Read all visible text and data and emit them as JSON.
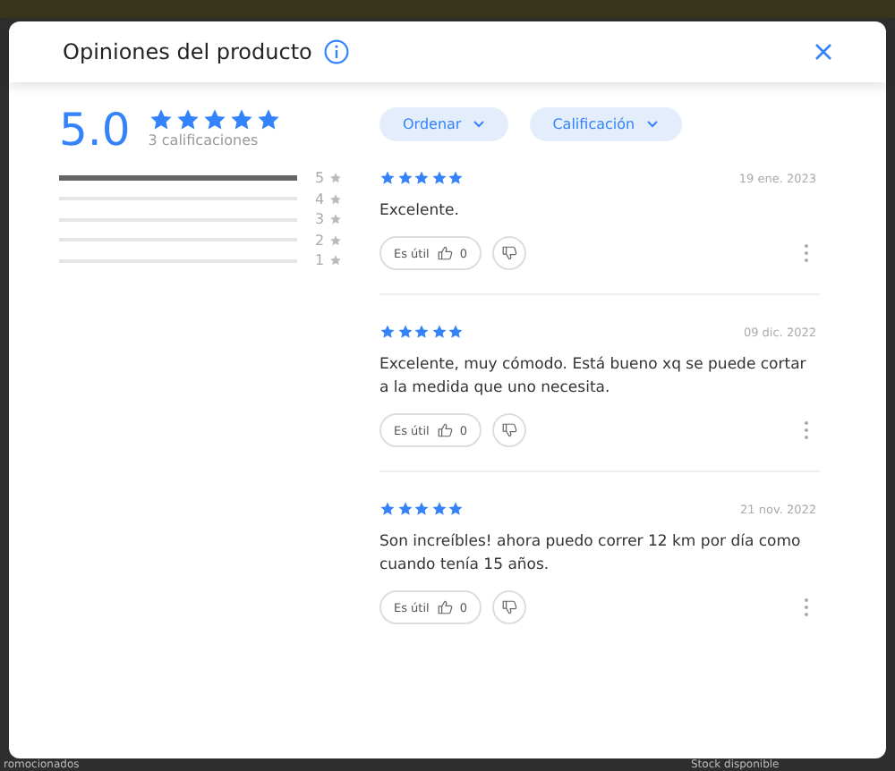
{
  "background": {
    "left_text": "romocionados",
    "right_text": "Stock disponible"
  },
  "modal": {
    "title": "Opiniones del producto",
    "summary": {
      "average": "5.0",
      "stars": 5,
      "count_label": "3 calificaciones",
      "distribution": [
        {
          "label": "5",
          "level": 1
        },
        {
          "label": "4",
          "level": 0
        },
        {
          "label": "3",
          "level": 0
        },
        {
          "label": "2",
          "level": 0
        },
        {
          "label": "1",
          "level": 0
        }
      ]
    },
    "filters": [
      "Ordenar",
      "Calificación"
    ],
    "reviews": [
      {
        "stars": 5,
        "date": "19 ene. 2023",
        "text": "Excelente.",
        "helpful_label": "Es útil",
        "likes": "0"
      },
      {
        "stars": 5,
        "date": "09 dic. 2022",
        "text": "Excelente, muy cómodo. Está bueno xq se puede cortar a la medida que uno necesita.",
        "helpful_label": "Es útil",
        "likes": "0"
      },
      {
        "stars": 5,
        "date": "21 nov. 2022",
        "text": "Son increíbles! ahora puedo correr 12 km por día como cuando tenía 15 años.",
        "helpful_label": "Es útil",
        "likes": "0"
      }
    ]
  }
}
